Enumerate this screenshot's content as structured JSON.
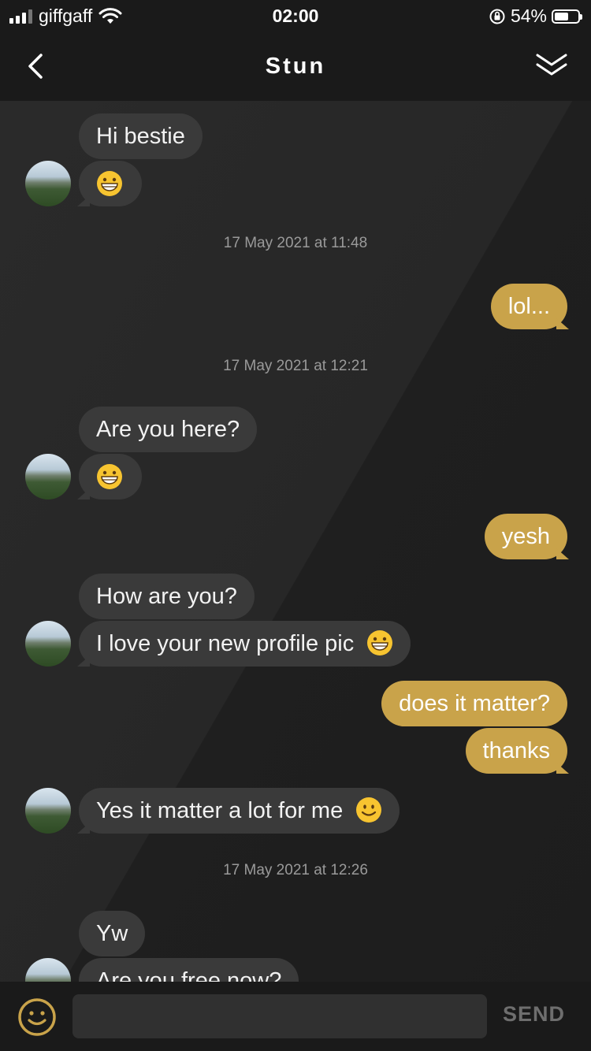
{
  "status_bar": {
    "carrier": "giffgaff",
    "time": "02:00",
    "battery_percent": "54%",
    "battery_level": 0.54,
    "icons": [
      "signal-icon",
      "wifi-icon",
      "orientation-lock-icon",
      "battery-icon"
    ]
  },
  "header": {
    "title": "Stun",
    "back_icon": "chevron-left-icon",
    "collapse_icon": "double-chevron-down-icon"
  },
  "messages": [
    {
      "side": "in",
      "text": "Hi bestie"
    },
    {
      "side": "in",
      "emoji": "grinning-face-icon"
    },
    {
      "timestamp": "17 May 2021 at 11:48"
    },
    {
      "side": "out",
      "text": "lol..."
    },
    {
      "timestamp": "17 May 2021 at 12:21"
    },
    {
      "side": "in",
      "text": "Are you here?"
    },
    {
      "side": "in",
      "emoji": "grinning-face-icon"
    },
    {
      "side": "out",
      "text": "yesh"
    },
    {
      "side": "in",
      "text": "How are you?"
    },
    {
      "side": "in",
      "text": "I love your new profile pic",
      "emoji": "grinning-face-icon"
    },
    {
      "side": "out",
      "text": "does it matter?"
    },
    {
      "side": "out",
      "text": "thanks"
    },
    {
      "side": "in",
      "text": "Yes it matter a lot for me",
      "emoji": "smiling-face-icon"
    },
    {
      "timestamp": "17 May 2021 at 12:26"
    },
    {
      "side": "in",
      "text": "Yw"
    },
    {
      "side": "in",
      "text": "Are you free now?"
    }
  ],
  "composer": {
    "emoji_icon": "smiley-icon",
    "input_value": "",
    "send_label": "SEND"
  },
  "colors": {
    "outgoing_bubble": "#c9a34a",
    "incoming_bubble": "#3a3a3a",
    "background": "#1c1c1c"
  }
}
